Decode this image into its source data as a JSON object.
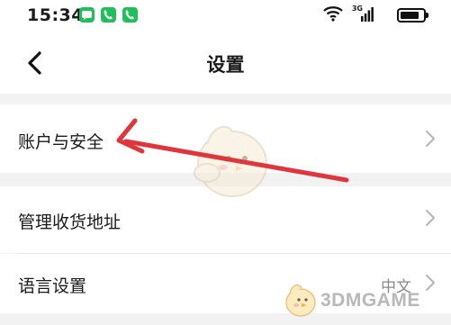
{
  "status_bar": {
    "time": "15:34",
    "network_type": "3G",
    "notification_icons": [
      "message-icon",
      "phone-icon",
      "phone-icon"
    ]
  },
  "nav": {
    "title": "设置"
  },
  "settings": {
    "account_security_label": "账户与安全",
    "address_label": "管理收货地址",
    "language_label": "语言设置",
    "language_value": "中文"
  },
  "watermark": {
    "text": "3DMGAME"
  },
  "colors": {
    "annotation_arrow": "#e0353a",
    "notification_green": "#1fbf5b"
  }
}
